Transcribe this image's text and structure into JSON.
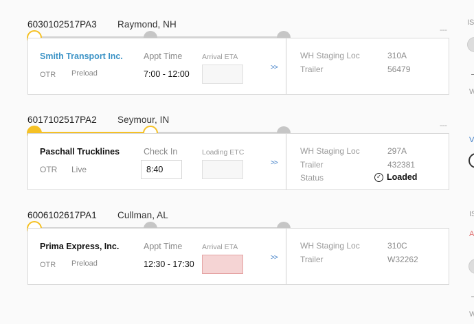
{
  "shipments": [
    {
      "id": "6030102517PA3",
      "location": "Raymond, NH",
      "carrier": "Smith Transport Inc.",
      "mode": "OTR",
      "load_type": "Preload",
      "time_label": "Appt Time",
      "time_value": "7:00 - 12:00",
      "eta_label": "Arrival ETA",
      "expand_icon": ">>",
      "wh_label": "WH Staging Loc",
      "wh_value": "310A",
      "trailer_label": "Trailer",
      "trailer_value": "56479",
      "more": "---",
      "progress_step": 0
    },
    {
      "id": "6017102517PA2",
      "location": "Seymour, IN",
      "carrier": "Paschall Trucklines",
      "mode": "OTR",
      "load_type": "Live",
      "time_label": "Check In",
      "time_value": "8:40",
      "eta_label": "Loading ETC",
      "expand_icon": ">>",
      "wh_label": "WH Staging Loc",
      "wh_value": "297A",
      "trailer_label": "Trailer",
      "trailer_value": "432381",
      "status_label": "Status",
      "status_value": "Loaded",
      "more": "---",
      "progress_step": 1
    },
    {
      "id": "6006102617PA1",
      "location": "Cullman, AL",
      "carrier": "Prima Express, Inc.",
      "mode": "OTR",
      "load_type": "Preload",
      "time_label": "Appt Time",
      "time_value": "12:30 - 17:30",
      "eta_label": "Arrival ETA",
      "expand_icon": ">>",
      "wh_label": "WH Staging Loc",
      "wh_value": "310C",
      "trailer_label": "Trailer",
      "trailer_value": "W32262",
      "more": "---",
      "progress_step": 0,
      "eta_alert": true
    }
  ],
  "side_panel": {
    "frag1": "IS",
    "frag2": "W",
    "frag3": "V",
    "frag4": "IS",
    "frag5": "A",
    "frag6": "W"
  },
  "colors": {
    "progress": "#f5c125",
    "link": "#3c93c6",
    "alert_bg": "#f5d4d4"
  }
}
